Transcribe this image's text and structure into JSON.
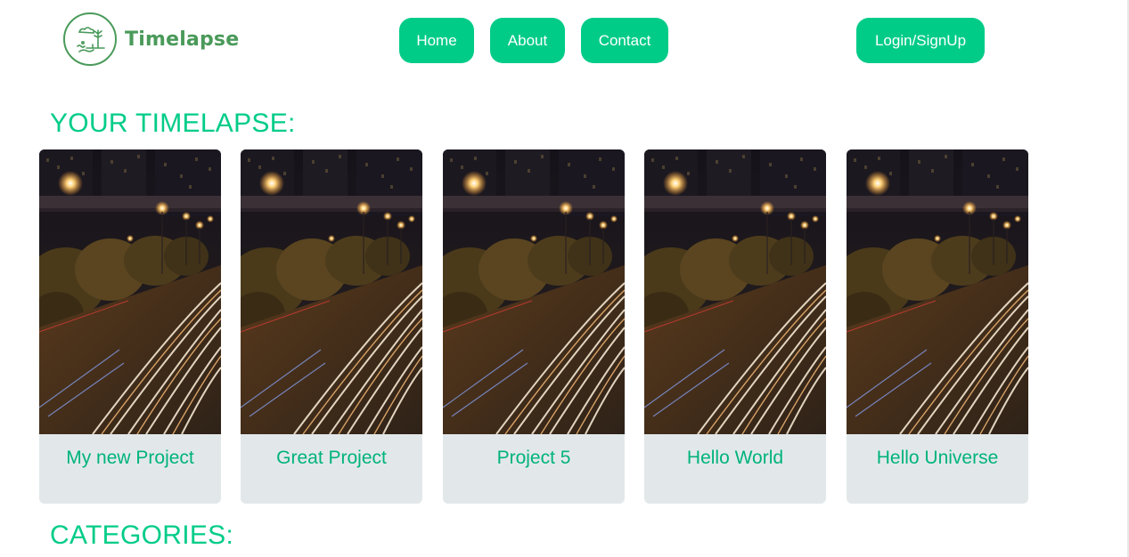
{
  "header": {
    "logo_text": "Timelapse",
    "nav": {
      "home": "Home",
      "about": "About",
      "contact": "Contact"
    },
    "login_label": "Login/SignUp"
  },
  "main": {
    "timelapse_heading": "YOUR TIMELAPSE:",
    "projects": [
      {
        "title": "My new Project",
        "thumbnail": "night-city-traffic-lights"
      },
      {
        "title": "Great Project",
        "thumbnail": "night-city-traffic-lights"
      },
      {
        "title": "Project 5",
        "thumbnail": "night-city-traffic-lights"
      },
      {
        "title": "Hello World",
        "thumbnail": "night-city-traffic-lights"
      },
      {
        "title": "Hello Universe",
        "thumbnail": "night-city-traffic-lights"
      }
    ],
    "categories_heading": "CATEGORIES:"
  },
  "colors": {
    "accent": "#00cc88",
    "logo_green": "#4a9a5a",
    "card_bg": "#e2e8ea"
  }
}
